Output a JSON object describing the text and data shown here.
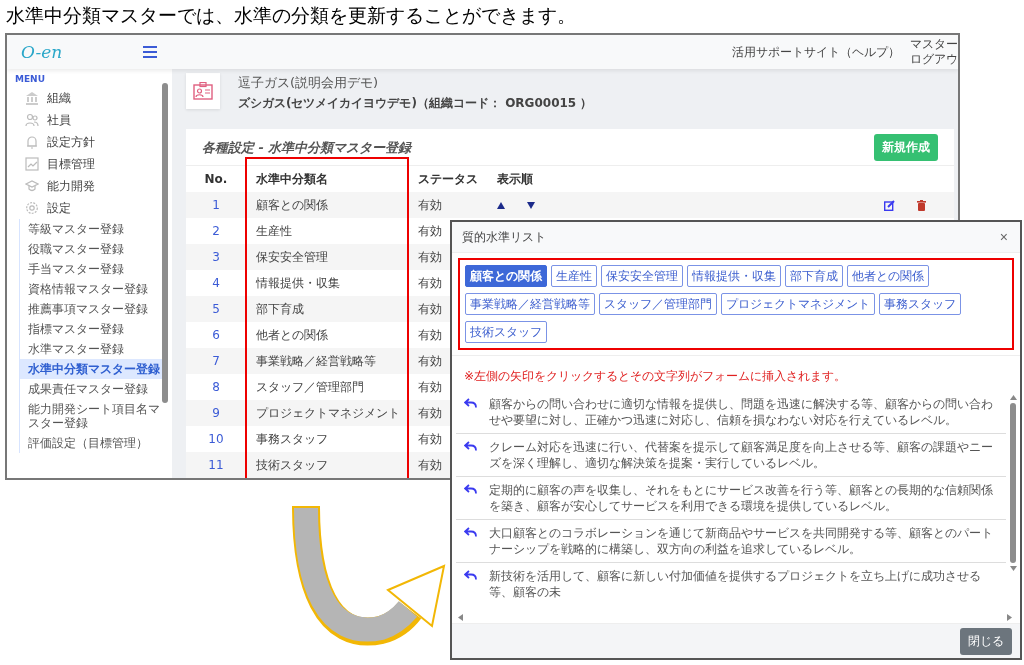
{
  "caption": "水準中分類マスターでは、水準の分類を更新することができます。",
  "app": {
    "logo": "O-en",
    "header_link": "活用サポートサイト（ヘルプ）",
    "user_lines": [
      "マスター",
      "ログアウ"
    ],
    "sidebar": {
      "heading": "MENU",
      "items": [
        {
          "label": "組織"
        },
        {
          "label": "社員"
        },
        {
          "label": "設定方針"
        },
        {
          "label": "目標管理"
        },
        {
          "label": "能力開発"
        },
        {
          "label": "設定",
          "children": [
            {
              "label": "等級マスター登録",
              "selected": false
            },
            {
              "label": "役職マスター登録",
              "selected": false
            },
            {
              "label": "手当マスター登録",
              "selected": false
            },
            {
              "label": "資格情報マスター登録",
              "selected": false
            },
            {
              "label": "推薦事項マスター登録",
              "selected": false
            },
            {
              "label": "指標マスター登録",
              "selected": false
            },
            {
              "label": "水準マスター登録",
              "selected": false
            },
            {
              "label": "水準中分類マスター登録",
              "selected": true
            },
            {
              "label": "成果責任マスター登録",
              "selected": false
            },
            {
              "label": "能力開発シート項目名マスター登録",
              "selected": false
            },
            {
              "label": "評価設定（目標管理）",
              "selected": false
            }
          ]
        }
      ]
    },
    "org": {
      "name": "逗子ガス(説明会用デモ)",
      "reading": "ズシガス(セツメイカイヨウデモ)（組織コード： ORG00015 ）"
    },
    "panel": {
      "title": "各種設定 - 水準中分類マスター登録",
      "new_button": "新規作成",
      "columns": [
        "No.",
        "水準中分類名",
        "ステータス",
        "表示順"
      ],
      "rows": [
        {
          "no": "1",
          "name": "顧客との関係",
          "status": "有効"
        },
        {
          "no": "2",
          "name": "生産性",
          "status": "有効"
        },
        {
          "no": "3",
          "name": "保安安全管理",
          "status": "有効"
        },
        {
          "no": "4",
          "name": "情報提供・収集",
          "status": "有効"
        },
        {
          "no": "5",
          "name": "部下育成",
          "status": "有効"
        },
        {
          "no": "6",
          "name": "他者との関係",
          "status": "有効"
        },
        {
          "no": "7",
          "name": "事業戦略／経営戦略等",
          "status": "有効"
        },
        {
          "no": "8",
          "name": "スタッフ／管理部門",
          "status": "有効"
        },
        {
          "no": "9",
          "name": "プロジェクトマネジメント",
          "status": "有効"
        },
        {
          "no": "10",
          "name": "事務スタッフ",
          "status": "有効"
        },
        {
          "no": "11",
          "name": "技術スタッフ",
          "status": "有効"
        }
      ]
    }
  },
  "modal": {
    "title": "質的水準リスト",
    "close": "×",
    "tags": [
      {
        "label": "顧客との関係",
        "selected": true
      },
      {
        "label": "生産性",
        "selected": false
      },
      {
        "label": "保安安全管理",
        "selected": false
      },
      {
        "label": "情報提供・収集",
        "selected": false
      },
      {
        "label": "部下育成",
        "selected": false
      },
      {
        "label": "他者との関係",
        "selected": false
      },
      {
        "label": "事業戦略／経営戦略等",
        "selected": false
      },
      {
        "label": "スタッフ／管理部門",
        "selected": false
      },
      {
        "label": "プロジェクトマネジメント",
        "selected": false
      },
      {
        "label": "事務スタッフ",
        "selected": false
      },
      {
        "label": "技術スタッフ",
        "selected": false
      }
    ],
    "note": "※左側の矢印をクリックするとその文字列がフォームに挿入されます。",
    "levels": [
      "顧客からの問い合わせに適切な情報を提供し、問題を迅速に解決する等、顧客からの問い合わせや要望に対し、正確かつ迅速に対応し、信頼を損なわない対応を行えているレベル。",
      "クレーム対応を迅速に行い、代替案を提示して顧客満足度を向上させる等、顧客の課題やニーズを深く理解し、適切な解決策を提案・実行しているレベル。",
      "定期的に顧客の声を収集し、それをもとにサービス改善を行う等、顧客との長期的な信頼関係を築き、顧客が安心してサービスを利用できる環境を提供しているレベル。",
      "大口顧客とのコラボレーションを通じて新商品やサービスを共同開発する等、顧客とのパートナーシップを戦略的に構築し、双方向の利益を追求しているレベル。",
      "新技術を活用して、顧客に新しい付加価値を提供するプロジェクトを立ち上げに成功させる等、顧客の未"
    ],
    "close_button": "閉じる"
  }
}
